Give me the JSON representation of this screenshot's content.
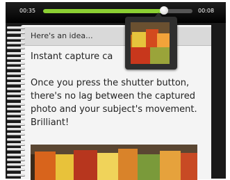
{
  "player": {
    "elapsed": "00:35",
    "remaining": "00:08",
    "progress": 0.81
  },
  "note": {
    "header": "Here's an idea...",
    "title": "Instant capture ca",
    "body": "Once you press the shutter button, there's no lag between the captured photo and your subject's movement. Brilliant!"
  },
  "colors": {
    "progress_fill": "#8cd033",
    "page_background": "#f4f4f4",
    "header_background": "#d9d9d9"
  },
  "icons": {
    "seek_thumb": "seek-thumb-icon",
    "binding": "spiral-binding-icon"
  }
}
